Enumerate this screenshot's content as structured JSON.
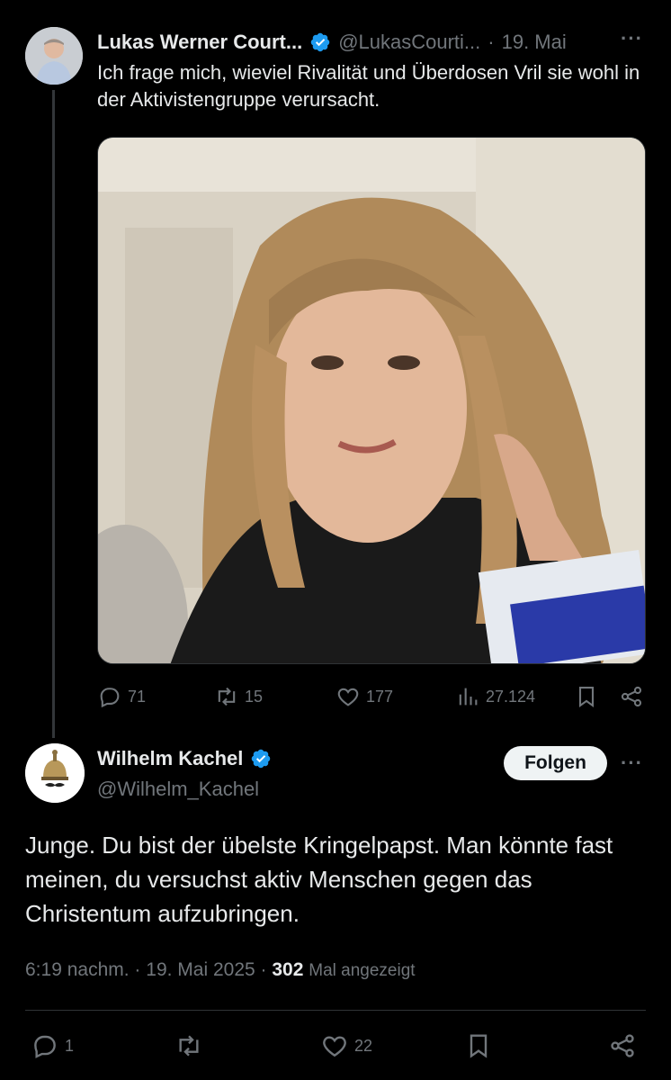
{
  "parent_tweet": {
    "author_name": "Lukas Werner Court...",
    "handle": "@LukasCourti...",
    "separator": "·",
    "date": "19. Mai",
    "more_icon": "more-horizontal-icon",
    "text": "Ich frage mich, wieviel Rivalität und Überdosen Vril sie wohl in der Aktivistengruppe verursacht.",
    "actions": {
      "replies": "71",
      "reposts": "15",
      "likes": "177",
      "views": "27.124"
    }
  },
  "reply_tweet": {
    "author_name": "Wilhelm Kachel",
    "handle": "@Wilhelm_Kachel",
    "follow_label": "Folgen",
    "text": "Junge. Du bist der übelste Kringelpapst. Man könnte fast meinen, du versuchst aktiv Menschen gegen das Christentum aufzubringen.",
    "time": "6:19 nachm.",
    "separator": "·",
    "date": "19. Mai 2025",
    "views_count": "302",
    "views_label": "Mal angezeigt",
    "actions": {
      "replies": "1",
      "likes": "22"
    }
  },
  "colors": {
    "background": "#000000",
    "text_primary": "#e7e9ea",
    "text_secondary": "#71767b",
    "verified_blue": "#1d9bf0",
    "follow_button_bg": "#eff3f4"
  }
}
